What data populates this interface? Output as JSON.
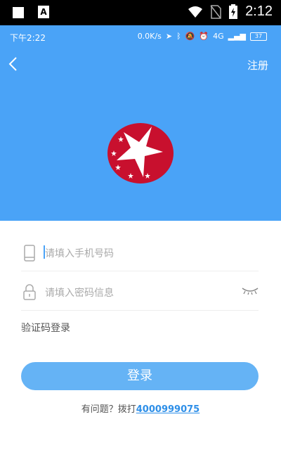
{
  "system_bar": {
    "time": "2:12"
  },
  "inner_status": {
    "time": "下午2:22",
    "speed": "0.0K/s",
    "network": "4G",
    "battery": "37"
  },
  "header": {
    "register": "注册"
  },
  "form": {
    "phone_placeholder": "请填入手机号码",
    "password_placeholder": "请填入密码信息",
    "sms_login": "验证码登录",
    "login_button": "登录"
  },
  "help": {
    "prefix": "有问题？拨打",
    "phone": "4000999075"
  },
  "colors": {
    "primary": "#4aa3f7",
    "button": "#65b3f5",
    "logo_red": "#c8102e"
  }
}
